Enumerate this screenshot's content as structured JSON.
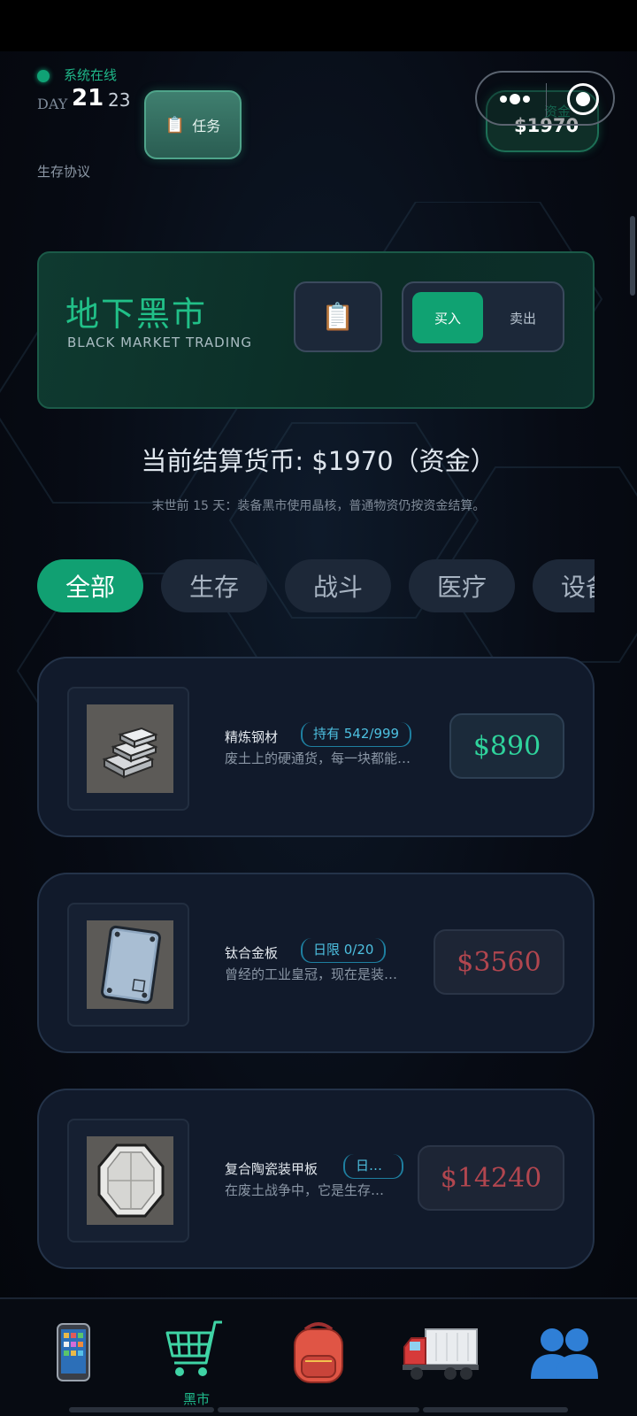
{
  "header": {
    "status": "系统在线",
    "day_label": "DAY",
    "day": "21",
    "time": "23",
    "subtitle": "生存协议",
    "task_button": "任务",
    "funds_label": "资金",
    "funds_value": "$1970",
    "capsule_more": "•●•"
  },
  "banner": {
    "title": "地下黑市",
    "subtitle": "BLACK MARKET TRADING",
    "log_icon": "clipboard-icon",
    "buy": "买入",
    "sell": "卖出"
  },
  "currency": {
    "line": "当前结算货币: $1970（资金）",
    "note": "末世前 15 天：装备黑市使用晶核，普通物资仍按资金结算。"
  },
  "tabs": [
    "全部",
    "生存",
    "战斗",
    "医疗",
    "设备"
  ],
  "active_tab": "全部",
  "items": [
    {
      "name": "精炼钢材",
      "badge": "持有 542/999",
      "desc": "废土上的硬通货，每一块都能…",
      "price": "$890",
      "affordable": true,
      "icon": "steel-ingots-icon"
    },
    {
      "name": "钛合金板",
      "badge": "日限 0/20",
      "desc": "曾经的工业皇冠，现在是装…",
      "price": "$3560",
      "affordable": false,
      "icon": "titanium-plate-icon"
    },
    {
      "name": "复合陶瓷装甲板",
      "badge": "日…",
      "desc": "在废土战争中，它是生存…",
      "price": "$14240",
      "affordable": false,
      "icon": "ceramic-armor-plate-icon"
    }
  ],
  "nav": [
    {
      "icon": "phone-icon",
      "label": ""
    },
    {
      "icon": "shopping-cart-icon",
      "label": "黑市",
      "active": true
    },
    {
      "icon": "backpack-icon",
      "label": ""
    },
    {
      "icon": "truck-icon",
      "label": ""
    },
    {
      "icon": "people-icon",
      "label": ""
    }
  ],
  "colors": {
    "accent": "#11a072",
    "affordable_price": "#2fd39c",
    "unaffordable_price": "#b1464f",
    "badge": "#4dc0e0"
  }
}
